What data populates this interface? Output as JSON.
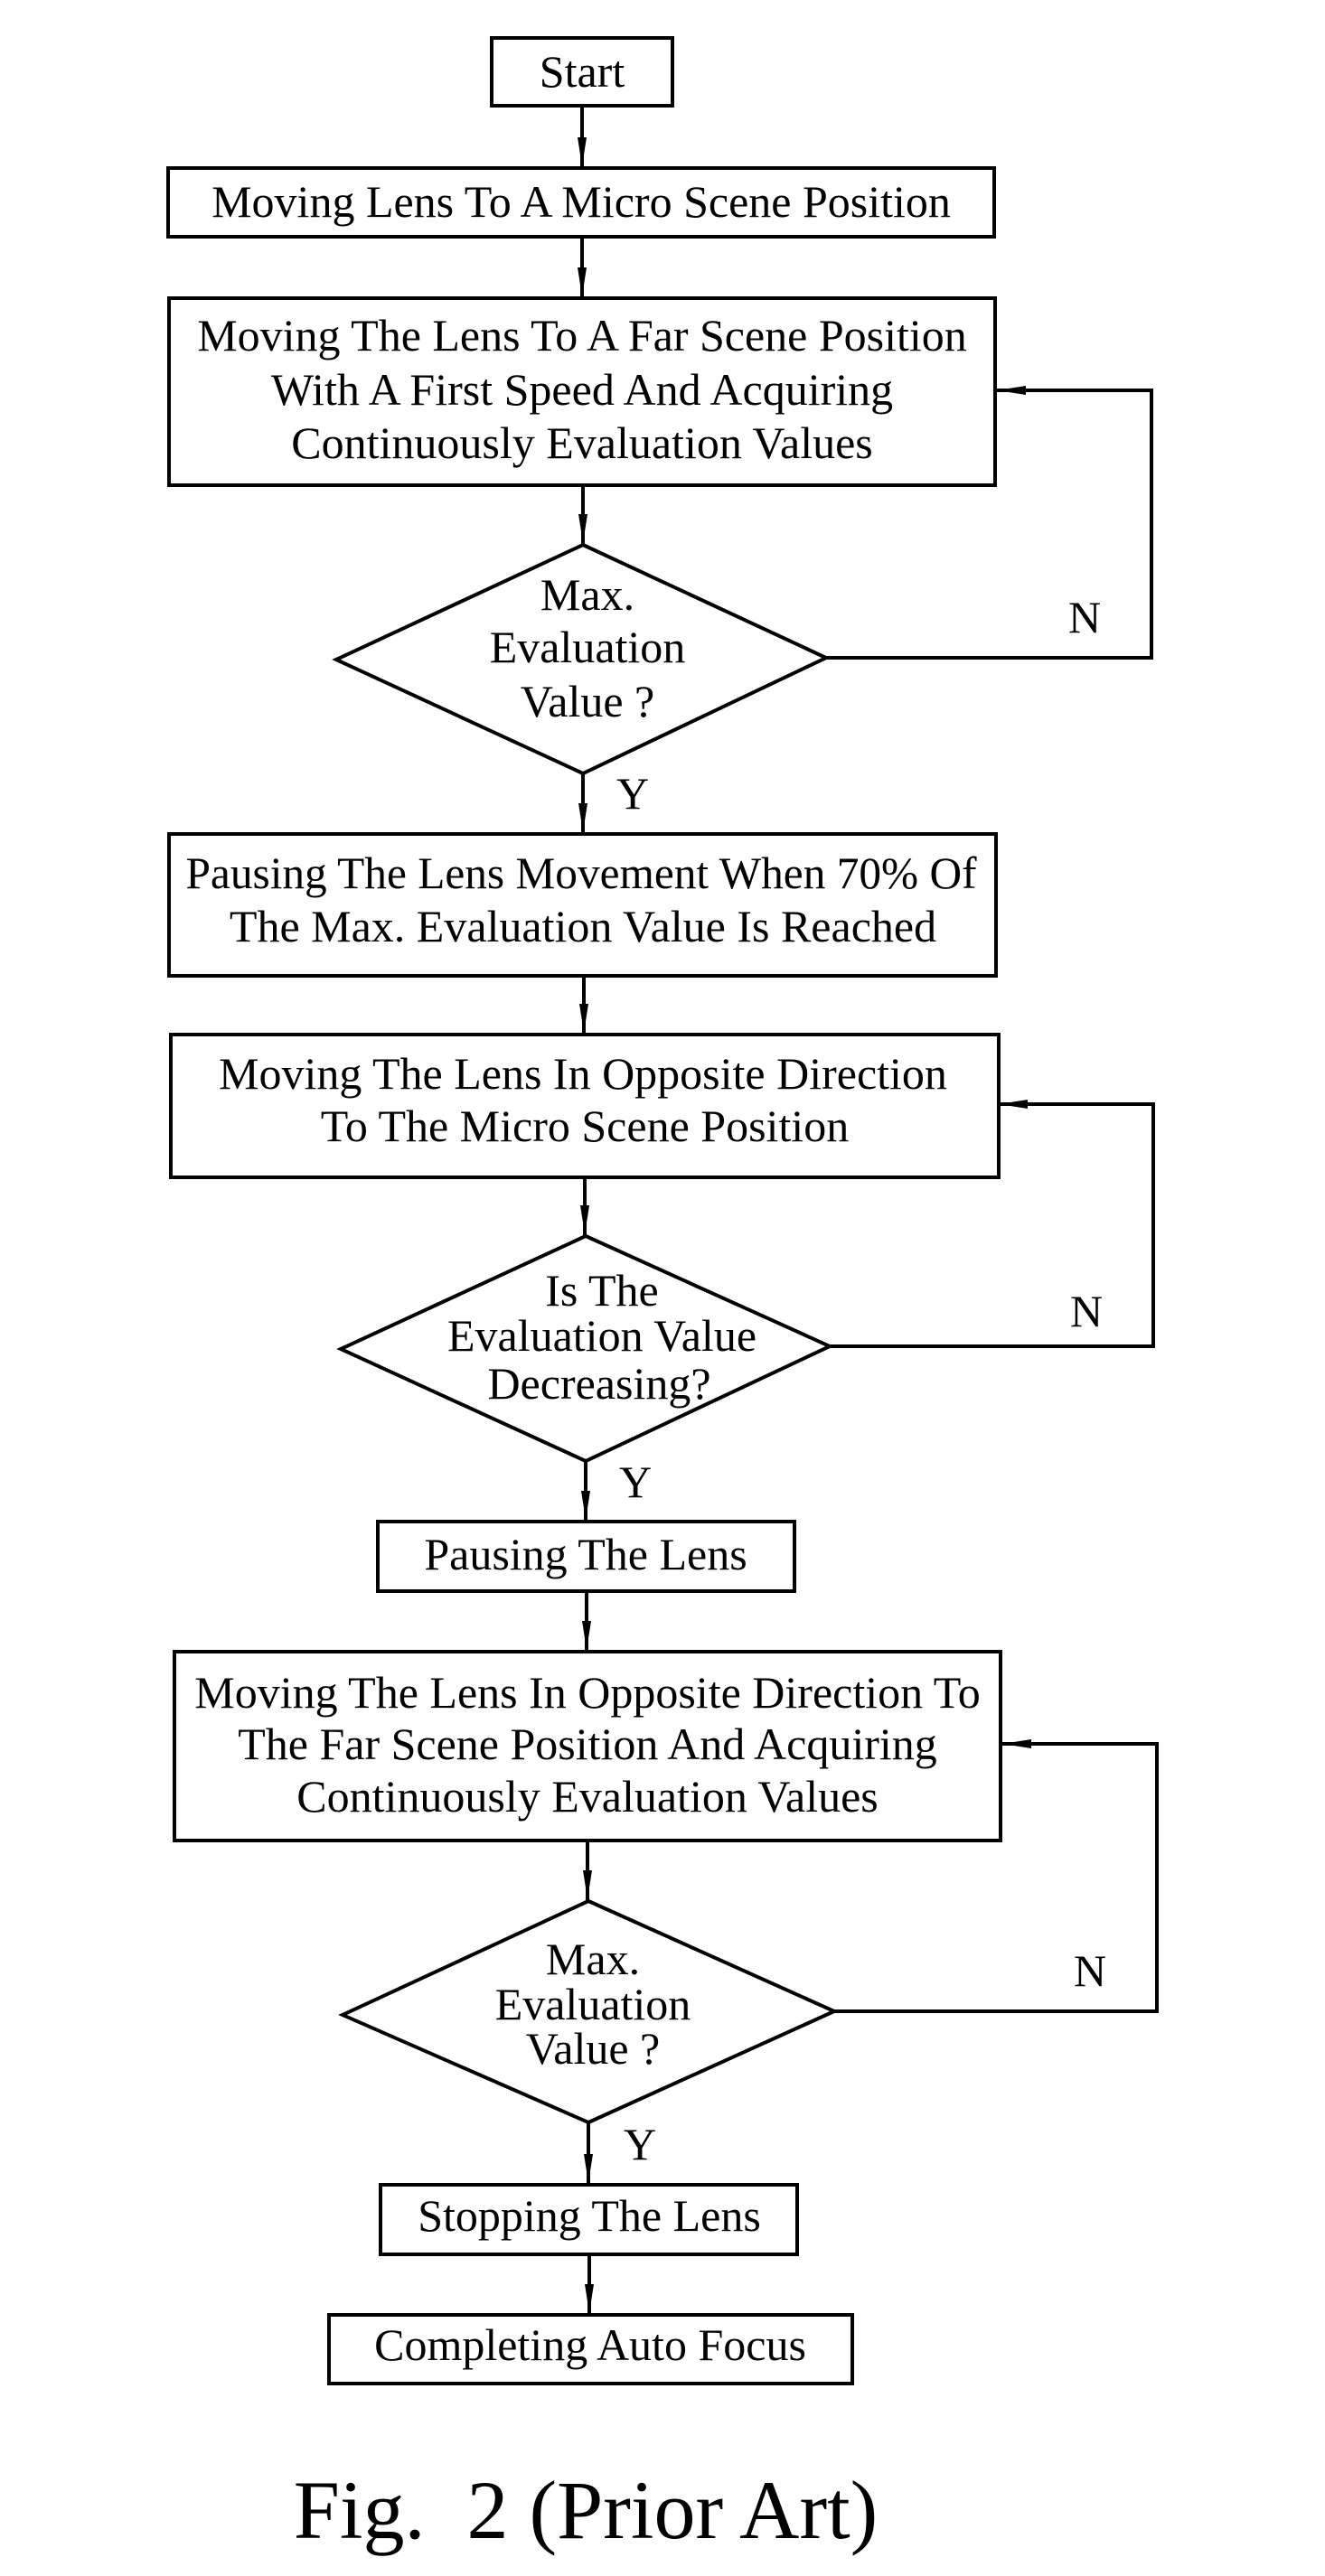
{
  "figure": {
    "caption": "Fig.  2 (Prior Art)",
    "colors": {
      "ink": "#000000",
      "paper": "#ffffff"
    }
  },
  "nodes": [
    {
      "id": "start",
      "type": "terminal",
      "lines": [
        "Start"
      ]
    },
    {
      "id": "move-micro",
      "type": "process",
      "lines": [
        "Moving Lens To A Micro Scene Position"
      ]
    },
    {
      "id": "move-far-first-speed",
      "type": "process",
      "lines": [
        "Moving The Lens To A Far Scene Position",
        "With A First Speed And Acquiring",
        "Continuously Evaluation Values"
      ]
    },
    {
      "id": "decision-max-1",
      "type": "decision",
      "lines": [
        "Max.",
        "Evaluation",
        "Value ?"
      ]
    },
    {
      "id": "pause-70",
      "type": "process",
      "lines": [
        "Pausing The Lens Movement When 70% Of",
        "The Max. Evaluation Value Is Reached"
      ]
    },
    {
      "id": "move-opposite-micro",
      "type": "process",
      "lines": [
        "Moving The Lens In Opposite Direction",
        "To The Micro Scene Position"
      ]
    },
    {
      "id": "decision-decreasing",
      "type": "decision",
      "lines": [
        "Is The",
        "Evaluation Value",
        "Decreasing?"
      ]
    },
    {
      "id": "pause-lens",
      "type": "process",
      "lines": [
        "Pausing The Lens"
      ]
    },
    {
      "id": "move-opposite-far",
      "type": "process",
      "lines": [
        "Moving The Lens In Opposite Direction To",
        "The Far Scene Position And Acquiring",
        "Continuously Evaluation Values"
      ]
    },
    {
      "id": "decision-max-2",
      "type": "decision",
      "lines": [
        "Max.",
        "Evaluation",
        "Value ?"
      ]
    },
    {
      "id": "stop-lens",
      "type": "process",
      "lines": [
        "Stopping The Lens"
      ]
    },
    {
      "id": "complete-af",
      "type": "terminal",
      "lines": [
        "Completing Auto Focus"
      ]
    }
  ],
  "edges": [
    {
      "from": "start",
      "to": "move-micro",
      "label": ""
    },
    {
      "from": "move-micro",
      "to": "move-far-first-speed",
      "label": ""
    },
    {
      "from": "move-far-first-speed",
      "to": "decision-max-1",
      "label": ""
    },
    {
      "from": "decision-max-1",
      "to": "move-far-first-speed",
      "label": "N"
    },
    {
      "from": "decision-max-1",
      "to": "pause-70",
      "label": "Y"
    },
    {
      "from": "pause-70",
      "to": "move-opposite-micro",
      "label": ""
    },
    {
      "from": "move-opposite-micro",
      "to": "decision-decreasing",
      "label": ""
    },
    {
      "from": "decision-decreasing",
      "to": "move-opposite-micro",
      "label": "N"
    },
    {
      "from": "decision-decreasing",
      "to": "pause-lens",
      "label": "Y"
    },
    {
      "from": "pause-lens",
      "to": "move-opposite-far",
      "label": ""
    },
    {
      "from": "move-opposite-far",
      "to": "decision-max-2",
      "label": ""
    },
    {
      "from": "decision-max-2",
      "to": "move-opposite-far",
      "label": "N"
    },
    {
      "from": "decision-max-2",
      "to": "stop-lens",
      "label": "Y"
    },
    {
      "from": "stop-lens",
      "to": "complete-af",
      "label": ""
    }
  ]
}
